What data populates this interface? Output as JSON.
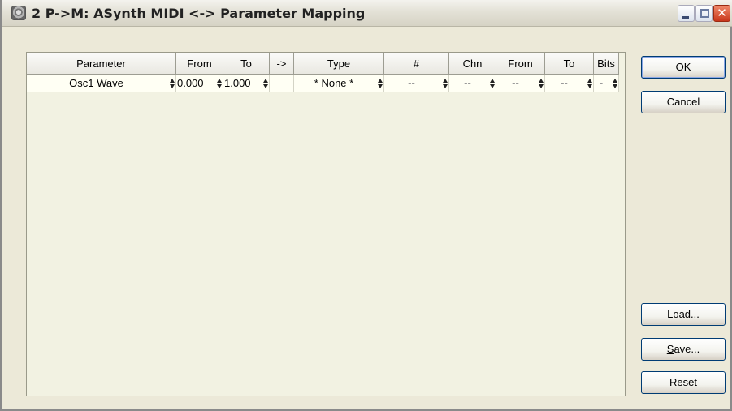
{
  "window": {
    "title": "2 P->M: ASynth MIDI <-> Parameter Mapping",
    "app_icon": "app-icon",
    "controls": {
      "minimize_icon": "minimize-icon",
      "maximize_icon": "maximize-icon",
      "close_icon": "close-icon",
      "close_glyph": "✕"
    }
  },
  "grid": {
    "columns": [
      "Parameter",
      "From",
      "To",
      "->",
      "Type",
      "#",
      "Chn",
      "From",
      "To",
      "Bits"
    ],
    "rows": [
      {
        "parameter": "Osc1 Wave",
        "from": "0.000",
        "to": "1.000",
        "arrow": "",
        "type": "* None *",
        "number": "--",
        "chn": "--",
        "midi_from": "--",
        "midi_to": "--",
        "bits": "-"
      }
    ]
  },
  "buttons": {
    "ok": "OK",
    "cancel": "Cancel",
    "load": {
      "mnemonic": "L",
      "rest": "oad..."
    },
    "save": {
      "mnemonic": "S",
      "rest": "ave..."
    },
    "reset": {
      "mnemonic": "R",
      "rest": "eset"
    }
  },
  "colors": {
    "title_bar": "#e3e1d6",
    "window_border": "#8a8a8a",
    "grid_background": "#f2f2e2",
    "close_button": "#c8361b"
  }
}
